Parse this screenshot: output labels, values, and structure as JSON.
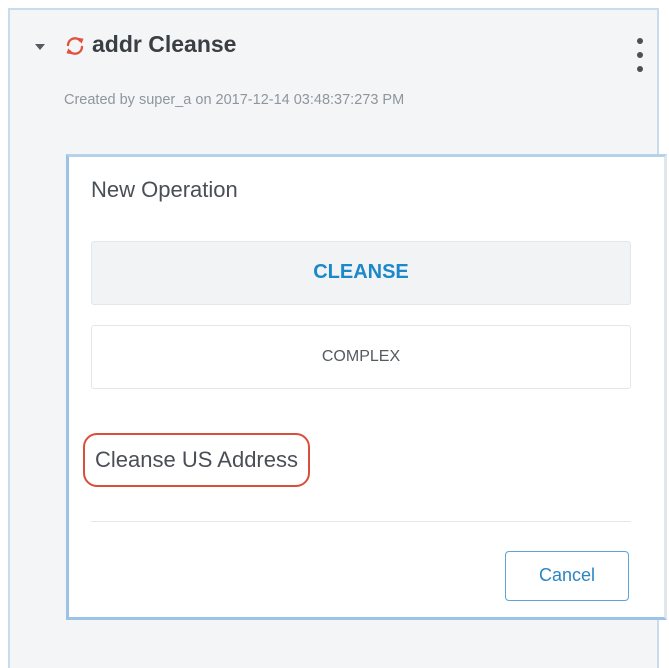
{
  "section": {
    "title": "addr Cleanse",
    "created_text": "Created by super_a on 2017-12-14 03:48:37:273 PM",
    "icons": {
      "expand": "caret-down-icon",
      "status": "refresh-icon",
      "menu": "kebab-menu-icon"
    },
    "colors": {
      "status_icon": "#e0523c"
    }
  },
  "operation_card": {
    "title": "New Operation",
    "options": [
      {
        "label": "CLEANSE",
        "selected": true
      },
      {
        "label": "COMPLEX",
        "selected": false
      }
    ],
    "description": "Cleanse US Address",
    "cancel_label": "Cancel",
    "colors": {
      "accent": "#1b88c9",
      "highlight_outline": "#d9503a"
    }
  }
}
